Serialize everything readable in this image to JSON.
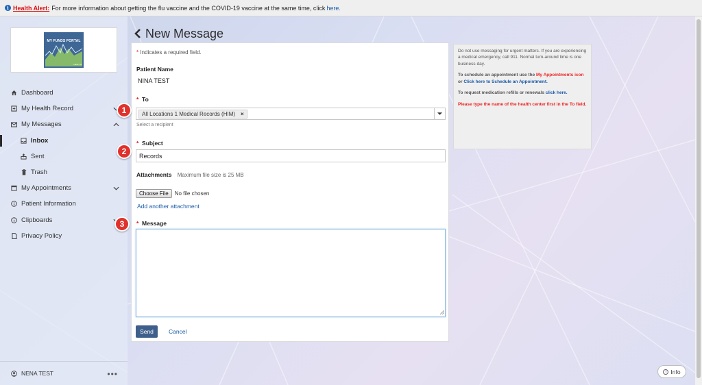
{
  "alert": {
    "label": "Health Alert:",
    "text": "For more information about getting the flu vaccine and the COVID-19 vaccine at the same time, click",
    "link": "here."
  },
  "logo": {
    "name": "MY FUNDS PORTAL",
    "sub": "HEALTH"
  },
  "sidebar": {
    "items": [
      {
        "label": "Dashboard",
        "icon": "home-icon"
      },
      {
        "label": "My Health Record",
        "icon": "medical-record-icon"
      },
      {
        "label": "My Messages",
        "icon": "envelope-icon"
      },
      {
        "label": "Inbox",
        "icon": "inbox-icon"
      },
      {
        "label": "Sent",
        "icon": "sent-icon"
      },
      {
        "label": "Trash",
        "icon": "trash-icon"
      },
      {
        "label": "My Appointments",
        "icon": "calendar-icon"
      },
      {
        "label": "Patient Information",
        "icon": "info-icon"
      },
      {
        "label": "Clipboards",
        "icon": "info-icon"
      },
      {
        "label": "Privacy Policy",
        "icon": "document-icon"
      }
    ],
    "user": "NENA TEST"
  },
  "page": {
    "title": "New Message"
  },
  "form": {
    "required_note": "Indicates a required field.",
    "patient_label": "Patient Name",
    "patient_value": "NINA TEST",
    "to_label": "To",
    "to_tag": "All Locations 1 Medical Records (HIM)",
    "to_hint": "Select a recipient",
    "subject_label": "Subject",
    "subject_value": "Records",
    "attachments_label": "Attachments",
    "attachments_note": "Maximum file size is 25 MB",
    "choose_file": "Choose File",
    "no_file": "No file chosen",
    "add_attachment": "Add another attachment",
    "message_label": "Message",
    "send": "Send",
    "cancel": "Cancel"
  },
  "badges": [
    "1",
    "2",
    "3"
  ],
  "info_panel": {
    "p1": "Do not use messaging for urgent matters. If you are experiencing a medical emergency, call 911. Normal turn-around time is one business day.",
    "p2_a": "To schedule an appointment use the",
    "p2_link1": "My Appointments icon",
    "p2_b": "or",
    "p2_link2": "Click here to Schedule an Appointment.",
    "p3_a": "To request medication refills or renewals",
    "p3_link": "click here.",
    "p4": "Please type the name of the health center first in the To field."
  },
  "info_button": "Info",
  "colors": {
    "accent": "#3e5f8c",
    "badge": "#e0312c",
    "alert": "#dd1111",
    "link": "#1a5aa8"
  }
}
